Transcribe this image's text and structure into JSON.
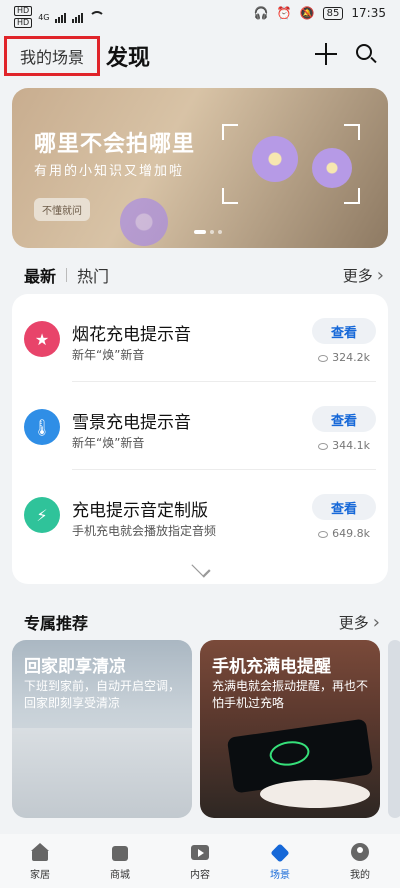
{
  "status_bar": {
    "sim1": "HD",
    "sim2": "HD",
    "signal1": "4G",
    "battery": "85",
    "time": "17:35"
  },
  "header": {
    "tab_my_scene": "我的场景",
    "tab_discover": "发现"
  },
  "banner": {
    "title": "哪里不会拍哪里",
    "subtitle": "有用的小知识又增加啦",
    "pill": "不懂就问"
  },
  "feed_tabs": {
    "latest": "最新",
    "hot": "热门",
    "more": "更多"
  },
  "items": [
    {
      "name": "烟花充电提示音",
      "desc": "新年“焕”新音",
      "view": "查看",
      "count": "324.2k",
      "icon": "star-icon",
      "color": "#e8446a"
    },
    {
      "name": "雪景充电提示音",
      "desc": "新年“焕”新音",
      "view": "查看",
      "count": "344.1k",
      "icon": "thermometer-icon",
      "color": "#2f8ee6"
    },
    {
      "name": "充电提示音定制版",
      "desc": "手机充电就会播放指定音频",
      "view": "查看",
      "count": "649.8k",
      "icon": "battery-icon",
      "color": "#2fc39a"
    }
  ],
  "exclusive": {
    "title": "专属推荐",
    "more": "更多",
    "cards": [
      {
        "title": "回家即享清凉",
        "desc": "下班到家前，自动开启空调，回家即刻享受清凉"
      },
      {
        "title": "手机充满电提醒",
        "desc": "充满电就会振动提醒，再也不怕手机过充咯"
      }
    ]
  },
  "bottom_nav": [
    {
      "label": "家居",
      "icon": "home-icon"
    },
    {
      "label": "商城",
      "icon": "shop-icon"
    },
    {
      "label": "内容",
      "icon": "play-icon"
    },
    {
      "label": "场景",
      "icon": "scene-cube-icon",
      "active": true
    },
    {
      "label": "我的",
      "icon": "profile-icon"
    }
  ]
}
